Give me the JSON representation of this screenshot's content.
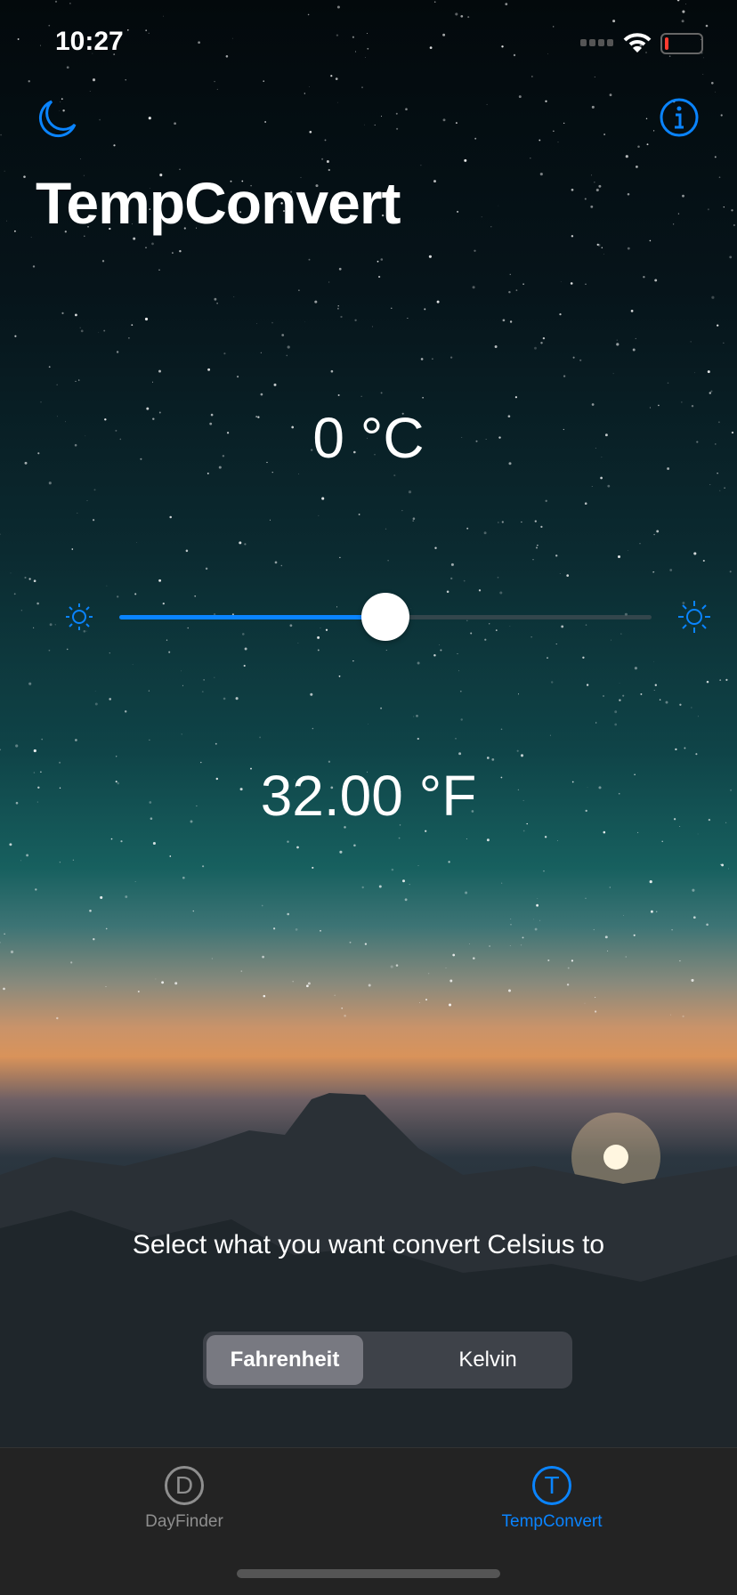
{
  "status_bar": {
    "time": "10:27",
    "battery_level": 0.1
  },
  "nav": {
    "left_icon": "moon-icon",
    "right_icon": "info-icon",
    "title": "TempConvert"
  },
  "converter": {
    "input_value": "0 °C",
    "output_value": "32.00 °F",
    "slider_fraction": 0.5,
    "min_icon": "sun-small-icon",
    "max_icon": "sun-large-icon"
  },
  "caption": "Select what you want convert Celsius to",
  "segments": [
    {
      "label": "Fahrenheit",
      "selected": true
    },
    {
      "label": "Kelvin",
      "selected": false
    }
  ],
  "tabs": [
    {
      "letter": "D",
      "label": "DayFinder",
      "active": false
    },
    {
      "letter": "T",
      "label": "TempConvert",
      "active": true
    }
  ],
  "colors": {
    "accent": "#0a84ff",
    "inactive": "#8e8e8e"
  }
}
